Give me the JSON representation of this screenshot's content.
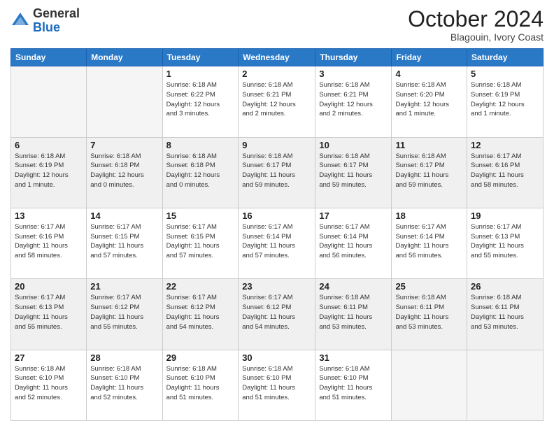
{
  "logo": {
    "general": "General",
    "blue": "Blue"
  },
  "header": {
    "month_year": "October 2024",
    "location": "Blagouin, Ivory Coast"
  },
  "weekdays": [
    "Sunday",
    "Monday",
    "Tuesday",
    "Wednesday",
    "Thursday",
    "Friday",
    "Saturday"
  ],
  "weeks": [
    [
      {
        "day": "",
        "info": ""
      },
      {
        "day": "",
        "info": ""
      },
      {
        "day": "1",
        "info": "Sunrise: 6:18 AM\nSunset: 6:22 PM\nDaylight: 12 hours\nand 3 minutes."
      },
      {
        "day": "2",
        "info": "Sunrise: 6:18 AM\nSunset: 6:21 PM\nDaylight: 12 hours\nand 2 minutes."
      },
      {
        "day": "3",
        "info": "Sunrise: 6:18 AM\nSunset: 6:21 PM\nDaylight: 12 hours\nand 2 minutes."
      },
      {
        "day": "4",
        "info": "Sunrise: 6:18 AM\nSunset: 6:20 PM\nDaylight: 12 hours\nand 1 minute."
      },
      {
        "day": "5",
        "info": "Sunrise: 6:18 AM\nSunset: 6:19 PM\nDaylight: 12 hours\nand 1 minute."
      }
    ],
    [
      {
        "day": "6",
        "info": "Sunrise: 6:18 AM\nSunset: 6:19 PM\nDaylight: 12 hours\nand 1 minute."
      },
      {
        "day": "7",
        "info": "Sunrise: 6:18 AM\nSunset: 6:18 PM\nDaylight: 12 hours\nand 0 minutes."
      },
      {
        "day": "8",
        "info": "Sunrise: 6:18 AM\nSunset: 6:18 PM\nDaylight: 12 hours\nand 0 minutes."
      },
      {
        "day": "9",
        "info": "Sunrise: 6:18 AM\nSunset: 6:17 PM\nDaylight: 11 hours\nand 59 minutes."
      },
      {
        "day": "10",
        "info": "Sunrise: 6:18 AM\nSunset: 6:17 PM\nDaylight: 11 hours\nand 59 minutes."
      },
      {
        "day": "11",
        "info": "Sunrise: 6:18 AM\nSunset: 6:17 PM\nDaylight: 11 hours\nand 59 minutes."
      },
      {
        "day": "12",
        "info": "Sunrise: 6:17 AM\nSunset: 6:16 PM\nDaylight: 11 hours\nand 58 minutes."
      }
    ],
    [
      {
        "day": "13",
        "info": "Sunrise: 6:17 AM\nSunset: 6:16 PM\nDaylight: 11 hours\nand 58 minutes."
      },
      {
        "day": "14",
        "info": "Sunrise: 6:17 AM\nSunset: 6:15 PM\nDaylight: 11 hours\nand 57 minutes."
      },
      {
        "day": "15",
        "info": "Sunrise: 6:17 AM\nSunset: 6:15 PM\nDaylight: 11 hours\nand 57 minutes."
      },
      {
        "day": "16",
        "info": "Sunrise: 6:17 AM\nSunset: 6:14 PM\nDaylight: 11 hours\nand 57 minutes."
      },
      {
        "day": "17",
        "info": "Sunrise: 6:17 AM\nSunset: 6:14 PM\nDaylight: 11 hours\nand 56 minutes."
      },
      {
        "day": "18",
        "info": "Sunrise: 6:17 AM\nSunset: 6:14 PM\nDaylight: 11 hours\nand 56 minutes."
      },
      {
        "day": "19",
        "info": "Sunrise: 6:17 AM\nSunset: 6:13 PM\nDaylight: 11 hours\nand 55 minutes."
      }
    ],
    [
      {
        "day": "20",
        "info": "Sunrise: 6:17 AM\nSunset: 6:13 PM\nDaylight: 11 hours\nand 55 minutes."
      },
      {
        "day": "21",
        "info": "Sunrise: 6:17 AM\nSunset: 6:12 PM\nDaylight: 11 hours\nand 55 minutes."
      },
      {
        "day": "22",
        "info": "Sunrise: 6:17 AM\nSunset: 6:12 PM\nDaylight: 11 hours\nand 54 minutes."
      },
      {
        "day": "23",
        "info": "Sunrise: 6:17 AM\nSunset: 6:12 PM\nDaylight: 11 hours\nand 54 minutes."
      },
      {
        "day": "24",
        "info": "Sunrise: 6:18 AM\nSunset: 6:11 PM\nDaylight: 11 hours\nand 53 minutes."
      },
      {
        "day": "25",
        "info": "Sunrise: 6:18 AM\nSunset: 6:11 PM\nDaylight: 11 hours\nand 53 minutes."
      },
      {
        "day": "26",
        "info": "Sunrise: 6:18 AM\nSunset: 6:11 PM\nDaylight: 11 hours\nand 53 minutes."
      }
    ],
    [
      {
        "day": "27",
        "info": "Sunrise: 6:18 AM\nSunset: 6:10 PM\nDaylight: 11 hours\nand 52 minutes."
      },
      {
        "day": "28",
        "info": "Sunrise: 6:18 AM\nSunset: 6:10 PM\nDaylight: 11 hours\nand 52 minutes."
      },
      {
        "day": "29",
        "info": "Sunrise: 6:18 AM\nSunset: 6:10 PM\nDaylight: 11 hours\nand 51 minutes."
      },
      {
        "day": "30",
        "info": "Sunrise: 6:18 AM\nSunset: 6:10 PM\nDaylight: 11 hours\nand 51 minutes."
      },
      {
        "day": "31",
        "info": "Sunrise: 6:18 AM\nSunset: 6:10 PM\nDaylight: 11 hours\nand 51 minutes."
      },
      {
        "day": "",
        "info": ""
      },
      {
        "day": "",
        "info": ""
      }
    ]
  ]
}
